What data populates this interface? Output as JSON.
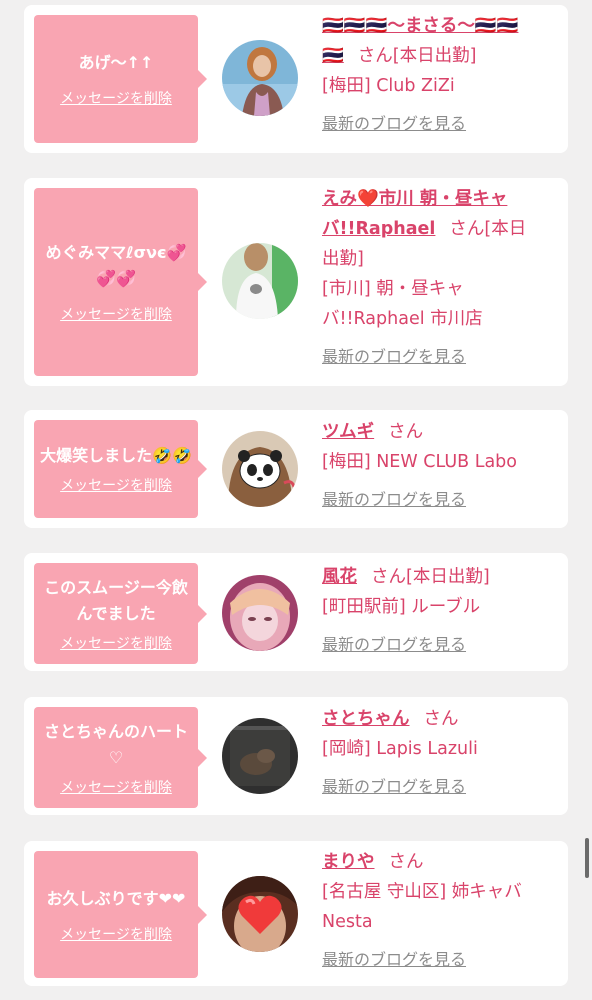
{
  "colors": {
    "accent_pink": "#d9436a",
    "bubble_pink": "#f9a5b2",
    "link_gray": "#8c8c8c",
    "background": "#f1f0f0"
  },
  "delete_label": "メッセージを削除",
  "blog_label": "最新のブログを見る",
  "honorific": "さん",
  "cards": [
    {
      "message": "あげ〜↑↑",
      "name_line1": "🇹🇭🇹🇭🇹🇭〜まさる〜🇹🇭🇹🇭",
      "name_line2": "🇹🇭",
      "status": "[本日出勤]",
      "shop": "[梅田] Club ZiZi",
      "avatar_icon": "avatar-photo-icon"
    },
    {
      "message": "めぐみママℓσνє💞💞💞",
      "name_line1": "えみ❤️市川 朝・昼キャ",
      "name_line2": "バ!!Raphael",
      "status": "[本日",
      "status2": "出勤]",
      "shop": "[市川] 朝・昼キャ",
      "shop2": "バ!!Raphael 市川店",
      "avatar_icon": "avatar-photo-icon"
    },
    {
      "message": "大爆笑しました🤣🤣",
      "name": "ツムギ",
      "shop": "[梅田] NEW CLUB Labo",
      "avatar_icon": "panda-avatar-icon"
    },
    {
      "message": "このスムージー今飲んでました",
      "name": "風花",
      "status": "[本日出勤]",
      "shop": "[町田駅前] ルーブル",
      "avatar_icon": "avatar-photo-icon"
    },
    {
      "message": "さとちゃんのハート♡",
      "name": "さとちゃん",
      "shop": "[岡崎] Lapis Lazuli",
      "avatar_icon": "avatar-photo-icon"
    },
    {
      "message": "お久しぶりです❤︎❤︎",
      "name": "まりや",
      "shop": "[名古屋 守山区] 姉キャバ",
      "shop2": "Nesta",
      "avatar_icon": "heart-avatar-icon"
    }
  ]
}
